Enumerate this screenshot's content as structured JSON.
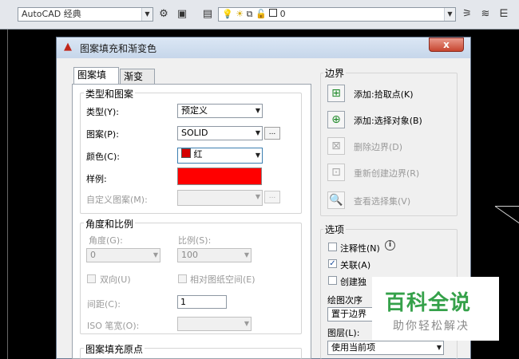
{
  "toolbar": {
    "workspace": "AutoCAD 经典",
    "layer_value": "0"
  },
  "dialog": {
    "title": "图案填充和渐变色",
    "close_symbol": "x",
    "tabs": [
      {
        "label": "图案填充",
        "active": true
      },
      {
        "label": "渐变色",
        "active": false
      }
    ],
    "type_pattern": {
      "group_label": "类型和图案",
      "type_label": "类型(Y):",
      "type_value": "预定义",
      "pattern_label": "图案(P):",
      "pattern_value": "SOLID",
      "browse": "...",
      "color_label": "颜色(C):",
      "color_value": "红",
      "swatch_label": "样例:",
      "swatch_color": "#ff0000",
      "custom_label": "自定义图案(M):",
      "custom_value": ""
    },
    "angle_scale": {
      "group_label": "角度和比例",
      "angle_label": "角度(G):",
      "angle_value": "0",
      "scale_label": "比例(S):",
      "scale_value": "100",
      "double_label": "双向(U)",
      "relative_label": "相对图纸空间(E)",
      "spacing_label": "间距(C):",
      "spacing_value": "1",
      "iso_label": "ISO 笔宽(O):",
      "iso_value": ""
    },
    "origin_group_label": "图案填充原点",
    "boundary": {
      "group_label": "边界",
      "items": [
        {
          "label": "添加:拾取点(K)",
          "enabled": true,
          "icon": "pick-points-icon"
        },
        {
          "label": "添加:选择对象(B)",
          "enabled": true,
          "icon": "select-objects-icon"
        },
        {
          "label": "删除边界(D)",
          "enabled": false,
          "icon": "remove-boundary-icon"
        },
        {
          "label": "重新创建边界(R)",
          "enabled": false,
          "icon": "recreate-boundary-icon"
        },
        {
          "label": "查看选择集(V)",
          "enabled": false,
          "icon": "view-selection-icon"
        }
      ]
    },
    "options": {
      "group_label": "选项",
      "annotative_label": "注释性(N)",
      "annotative_checked": false,
      "associative_label": "关联(A)",
      "associative_checked": true,
      "create_separate_label": "创建独",
      "create_separate_checked": false,
      "draw_order_label": "绘图次序",
      "draw_order_value": "置于边界",
      "layer_label": "图层(L):",
      "layer_value": "使用当前项"
    }
  },
  "watermark": {
    "main": "百科全说",
    "sub": "助你轻松解决"
  }
}
